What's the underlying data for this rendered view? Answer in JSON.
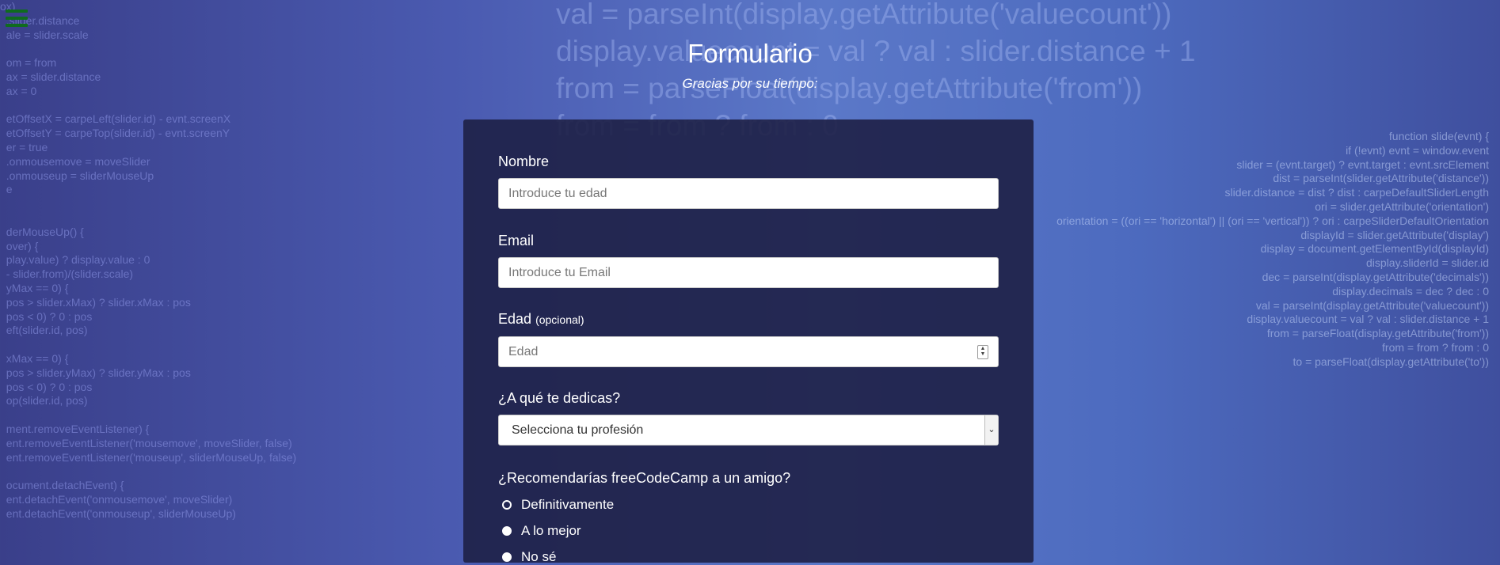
{
  "menu": {
    "icon": "hamburger-icon",
    "color": "#0f6b1f"
  },
  "header": {
    "title": "Formulario",
    "subtitle": "Gracias por su tiempo:"
  },
  "form": {
    "name": {
      "label": "Nombre",
      "placeholder": "Introduce tu edad"
    },
    "email": {
      "label": "Email",
      "placeholder": "Introduce tu Email"
    },
    "age": {
      "label": "Edad",
      "label_optional": "(opcional)",
      "placeholder": "Edad"
    },
    "profession": {
      "label": "¿A qué te dedicas?",
      "selected": "Selecciona tu profesión"
    },
    "recommend": {
      "label": "¿Recomendarías freeCodeCamp a un amigo?",
      "options": [
        "Definitivamente",
        "A lo mejor",
        "No sé"
      ]
    }
  },
  "colors": {
    "card": "#1e2046",
    "text": "#ffffff"
  }
}
